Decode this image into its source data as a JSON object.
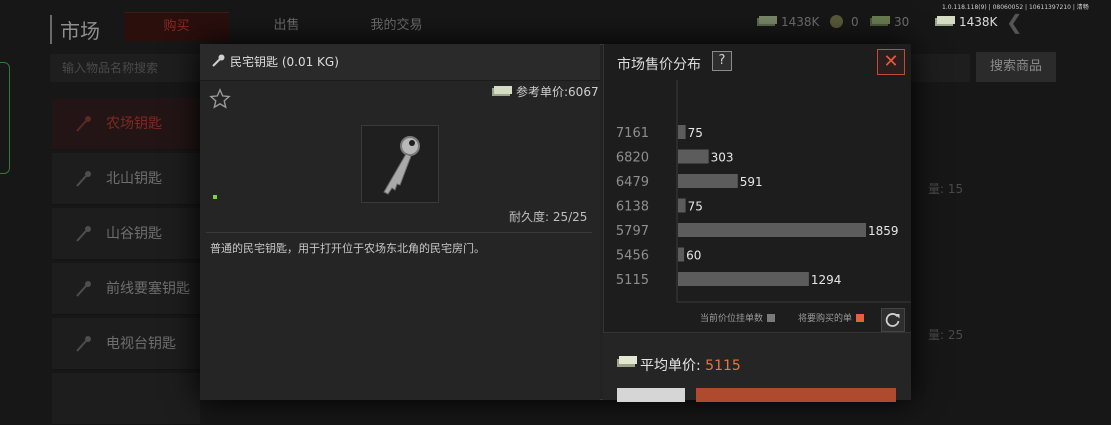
{
  "top_bar": {
    "version_info": "1.0.118.118(9) | 08060052 | 10611397210 | 清畅",
    "bg_cash": "1438K",
    "bg_coins": "0",
    "bg_bonds": "30",
    "cash": "1438K"
  },
  "background": {
    "title": "市场",
    "tabs": [
      "购买",
      "出售",
      "我的交易"
    ],
    "active_tab_index": 0,
    "search_placeholder": "输入物品名称搜索",
    "search_button": "搜索商品",
    "categories": [
      "农场钥匙",
      "北山钥匙",
      "山谷钥匙",
      "前线要塞钥匙",
      "电视台钥匙"
    ],
    "active_category_index": 0,
    "right_snippets": [
      "量: 15",
      "量: 25"
    ]
  },
  "item": {
    "name": "民宅钥匙 (0.01 KG)",
    "ref_price": "参考单价:6067",
    "durability": "耐久度: 25/25",
    "description": "普通的民宅钥匙，用于打开位于农场东北角的民宅房门。"
  },
  "market": {
    "title": "市场售价分布",
    "help_label": "?",
    "close_label": "✕",
    "legend_current": "当前价位挂单数",
    "legend_buy": "将要购买的单",
    "avg_label": "平均单价:",
    "avg_value": "5115",
    "colors": {
      "bar": "#5c5c5c",
      "buy": "#e0623e",
      "accent": "#e8743f"
    }
  },
  "chart_data": {
    "type": "bar",
    "orientation": "horizontal",
    "categories": [
      "7161",
      "6820",
      "6479",
      "6138",
      "5797",
      "5456",
      "5115"
    ],
    "values": [
      75,
      303,
      591,
      75,
      1859,
      60,
      1294
    ],
    "xlabel": "",
    "ylabel": "",
    "grid": false
  }
}
